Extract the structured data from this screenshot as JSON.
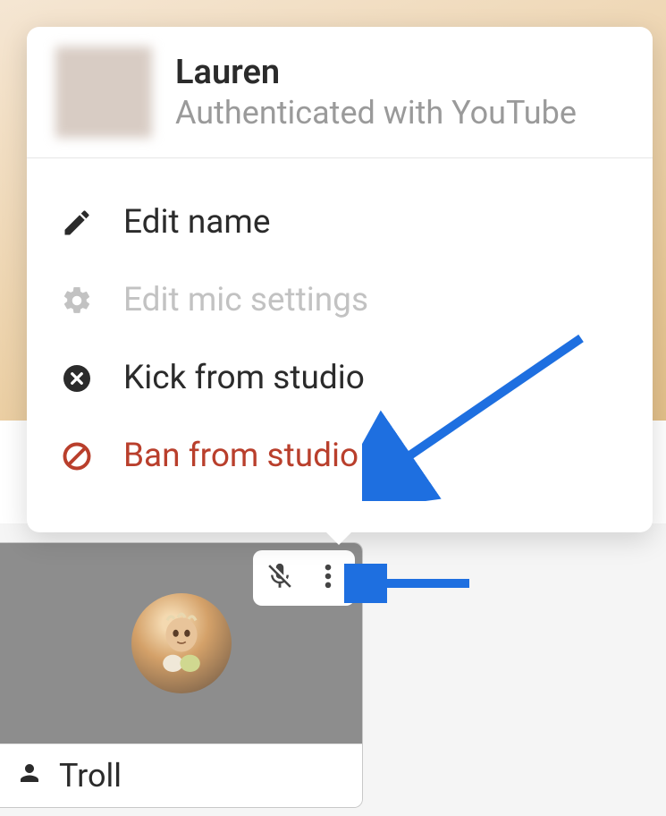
{
  "popover": {
    "user_name": "Lauren",
    "auth_text": "Authenticated with YouTube"
  },
  "menu": {
    "edit_name": "Edit name",
    "edit_mic": "Edit mic settings",
    "kick": "Kick from studio",
    "ban": "Ban from studio"
  },
  "participant": {
    "name": "Troll"
  },
  "colors": {
    "danger": "#b93f2c",
    "disabled": "#c2c2c2",
    "text": "#2b2b2b",
    "arrow": "#1e6fe0"
  }
}
